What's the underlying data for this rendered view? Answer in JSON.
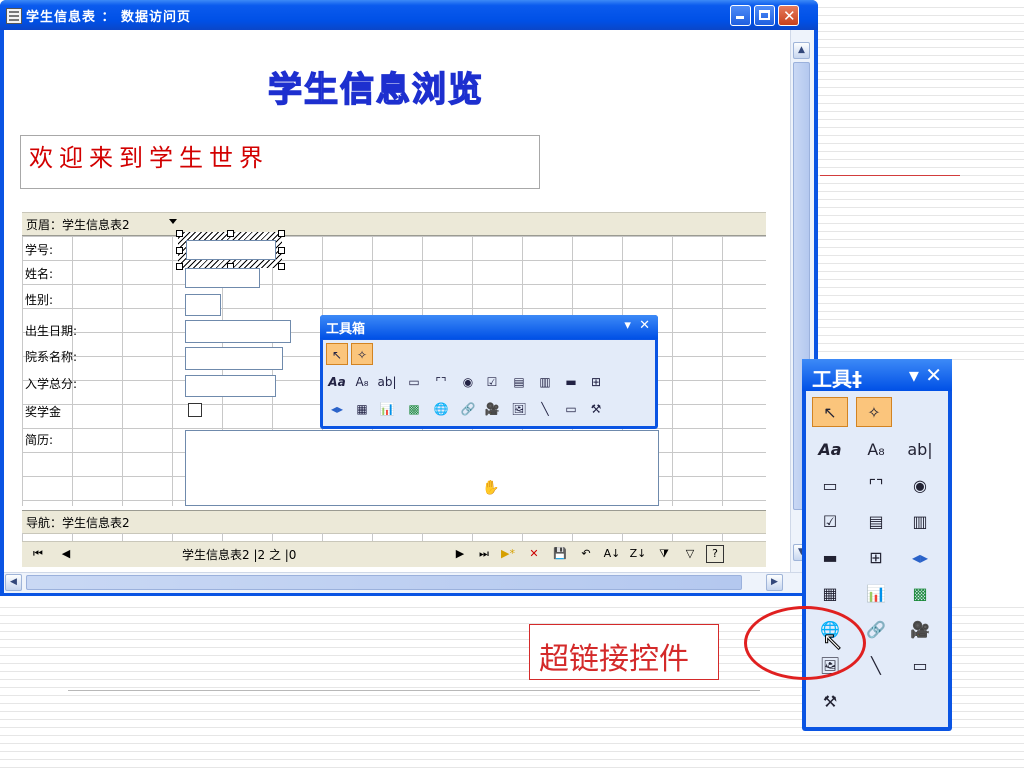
{
  "window": {
    "title": "学生信息表 ： 数据访问页"
  },
  "page": {
    "heading": "学生信息浏览",
    "welcome": "欢迎来到学生世界",
    "header_section": "页眉：学生信息表2",
    "nav_section": "导航：学生信息表2",
    "fields": [
      {
        "label": "学号:"
      },
      {
        "label": "姓名:"
      },
      {
        "label": "性别:"
      },
      {
        "label": "出生日期:"
      },
      {
        "label": "院系名称:"
      },
      {
        "label": "入学总分:"
      },
      {
        "label": "奖学金"
      },
      {
        "label": "简历:"
      }
    ],
    "record_nav_text": "学生信息表2  |2 之 |0"
  },
  "toolbox": {
    "title": "工具箱",
    "title_small": "工具箱"
  },
  "vertical_toolbox": {
    "title": "工具‡"
  },
  "callout": {
    "text": "超链接控件"
  },
  "colors": {
    "titlebar": "#0050e6",
    "heading_outline": "#1d2fcf",
    "welcome": "#d20000",
    "callout": "#d42a2a"
  }
}
